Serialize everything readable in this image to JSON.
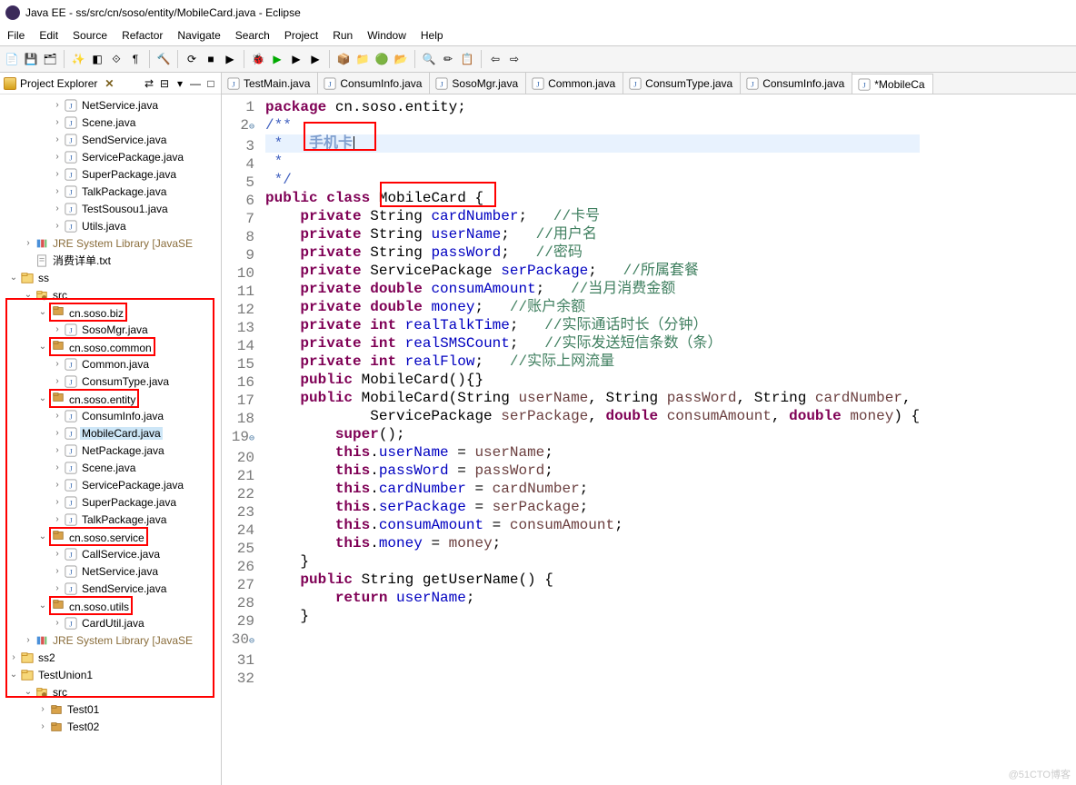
{
  "title": "Java EE - ss/src/cn/soso/entity/MobileCard.java - Eclipse",
  "menu": [
    "File",
    "Edit",
    "Source",
    "Refactor",
    "Navigate",
    "Search",
    "Project",
    "Run",
    "Window",
    "Help"
  ],
  "projectExplorer": {
    "title": "Project Explorer",
    "badge": "✕",
    "nodes": [
      {
        "depth": 3,
        "arrow": " >",
        "icon": "J",
        "label": "NetService.java"
      },
      {
        "depth": 3,
        "arrow": " >",
        "icon": "J",
        "label": "Scene.java"
      },
      {
        "depth": 3,
        "arrow": " >",
        "icon": "J",
        "label": "SendService.java"
      },
      {
        "depth": 3,
        "arrow": " >",
        "icon": "J",
        "label": "ServicePackage.java"
      },
      {
        "depth": 3,
        "arrow": " >",
        "icon": "J",
        "label": "SuperPackage.java"
      },
      {
        "depth": 3,
        "arrow": " >",
        "icon": "J",
        "label": "TalkPackage.java"
      },
      {
        "depth": 3,
        "arrow": " >",
        "icon": "J",
        "label": "TestSousou1.java"
      },
      {
        "depth": 3,
        "arrow": " >",
        "icon": "J",
        "label": "Utils.java"
      },
      {
        "depth": 1,
        "arrow": " >",
        "icon": "lib",
        "label": "JRE System Library [JavaSE"
      },
      {
        "depth": 1,
        "arrow": "",
        "icon": "txt",
        "label": "消费详单.txt"
      },
      {
        "depth": 0,
        "arrow": "v",
        "icon": "proj",
        "label": "ss"
      },
      {
        "depth": 1,
        "arrow": "v",
        "icon": "srcf",
        "label": "src"
      },
      {
        "depth": 2,
        "arrow": "v",
        "icon": "pkg",
        "label": "cn.soso.biz",
        "boxed": true
      },
      {
        "depth": 3,
        "arrow": " >",
        "icon": "J",
        "label": "SosoMgr.java"
      },
      {
        "depth": 2,
        "arrow": "v",
        "icon": "pkg",
        "label": "cn.soso.common",
        "boxed": true
      },
      {
        "depth": 3,
        "arrow": " >",
        "icon": "J",
        "label": "Common.java"
      },
      {
        "depth": 3,
        "arrow": " >",
        "icon": "J",
        "label": "ConsumType.java"
      },
      {
        "depth": 2,
        "arrow": "v",
        "icon": "pkg",
        "label": "cn.soso.entity",
        "boxed": true
      },
      {
        "depth": 3,
        "arrow": " >",
        "icon": "J",
        "label": "ConsumInfo.java"
      },
      {
        "depth": 3,
        "arrow": " >",
        "icon": "J",
        "label": "MobileCard.java",
        "sel": true
      },
      {
        "depth": 3,
        "arrow": " >",
        "icon": "J",
        "label": "NetPackage.java"
      },
      {
        "depth": 3,
        "arrow": " >",
        "icon": "J",
        "label": "Scene.java"
      },
      {
        "depth": 3,
        "arrow": " >",
        "icon": "J",
        "label": "ServicePackage.java"
      },
      {
        "depth": 3,
        "arrow": " >",
        "icon": "J",
        "label": "SuperPackage.java"
      },
      {
        "depth": 3,
        "arrow": " >",
        "icon": "J",
        "label": "TalkPackage.java"
      },
      {
        "depth": 2,
        "arrow": "v",
        "icon": "pkg",
        "label": "cn.soso.service",
        "boxed": true
      },
      {
        "depth": 3,
        "arrow": " >",
        "icon": "J",
        "label": "CallService.java"
      },
      {
        "depth": 3,
        "arrow": " >",
        "icon": "J",
        "label": "NetService.java"
      },
      {
        "depth": 3,
        "arrow": " >",
        "icon": "J",
        "label": "SendService.java"
      },
      {
        "depth": 2,
        "arrow": "v",
        "icon": "pkg",
        "label": "cn.soso.utils",
        "boxed": true
      },
      {
        "depth": 3,
        "arrow": " >",
        "icon": "J",
        "label": "CardUtil.java"
      },
      {
        "depth": 1,
        "arrow": " >",
        "icon": "lib",
        "label": "JRE System Library [JavaSE"
      },
      {
        "depth": 0,
        "arrow": " >",
        "icon": "proj",
        "label": "ss2"
      },
      {
        "depth": 0,
        "arrow": "v",
        "icon": "proj",
        "label": "TestUnion1"
      },
      {
        "depth": 1,
        "arrow": "v",
        "icon": "srcf",
        "label": "src"
      },
      {
        "depth": 2,
        "arrow": " >",
        "icon": "pkg",
        "label": "Test01"
      },
      {
        "depth": 2,
        "arrow": " >",
        "icon": "pkg",
        "label": "Test02"
      }
    ]
  },
  "tabs": [
    {
      "label": "TestMain.java"
    },
    {
      "label": "ConsumInfo.java"
    },
    {
      "label": "SosoMgr.java"
    },
    {
      "label": "Common.java"
    },
    {
      "label": "ConsumType.java"
    },
    {
      "label": "ConsumInfo.java"
    },
    {
      "label": "*MobileCa",
      "active": true
    }
  ],
  "code": {
    "lines": [
      {
        "n": 1,
        "seg": [
          [
            "kw",
            "package"
          ],
          [
            "tk",
            " cn.soso.entity"
          ],
          [
            "tk",
            ";"
          ]
        ]
      },
      {
        "n": 2,
        "fold": "⊖",
        "seg": [
          [
            "jd",
            "/**"
          ]
        ]
      },
      {
        "n": 3,
        "hl": true,
        "seg": [
          [
            "jd",
            " *   "
          ],
          [
            "jdk",
            "手机卡"
          ],
          [
            "cursor",
            ""
          ]
        ]
      },
      {
        "n": 4,
        "seg": [
          [
            "jd",
            " *"
          ]
        ]
      },
      {
        "n": 5,
        "seg": [
          [
            "jd",
            " */"
          ]
        ]
      },
      {
        "n": 6,
        "seg": [
          [
            "kw",
            "public"
          ],
          [
            "tk",
            " "
          ],
          [
            "kw",
            "class"
          ],
          [
            "tk",
            " MobileCard "
          ],
          [
            "tk",
            "{"
          ]
        ]
      },
      {
        "n": 7,
        "seg": [
          [
            "tk",
            "    "
          ],
          [
            "kw",
            "private"
          ],
          [
            "tk",
            " String "
          ],
          [
            "fld",
            "cardNumber"
          ],
          [
            "tk",
            ";   "
          ],
          [
            "cm",
            "//卡号"
          ]
        ]
      },
      {
        "n": 8,
        "seg": [
          [
            "tk",
            "    "
          ],
          [
            "kw",
            "private"
          ],
          [
            "tk",
            " String "
          ],
          [
            "fld",
            "userName"
          ],
          [
            "tk",
            ";   "
          ],
          [
            "cm",
            "//用户名"
          ]
        ]
      },
      {
        "n": 9,
        "seg": [
          [
            "tk",
            "    "
          ],
          [
            "kw",
            "private"
          ],
          [
            "tk",
            " String "
          ],
          [
            "fld",
            "passWord"
          ],
          [
            "tk",
            ";   "
          ],
          [
            "cm",
            "//密码"
          ]
        ]
      },
      {
        "n": 10,
        "seg": [
          [
            "tk",
            "    "
          ],
          [
            "kw",
            "private"
          ],
          [
            "tk",
            " ServicePackage "
          ],
          [
            "fld",
            "serPackage"
          ],
          [
            "tk",
            ";   "
          ],
          [
            "cm",
            "//所属套餐"
          ]
        ]
      },
      {
        "n": 11,
        "seg": [
          [
            "tk",
            "    "
          ],
          [
            "kw",
            "private"
          ],
          [
            "tk",
            " "
          ],
          [
            "kw",
            "double"
          ],
          [
            "tk",
            " "
          ],
          [
            "fld",
            "consumAmount"
          ],
          [
            "tk",
            ";   "
          ],
          [
            "cm",
            "//当月消费金额"
          ]
        ]
      },
      {
        "n": 12,
        "seg": [
          [
            "tk",
            "    "
          ],
          [
            "kw",
            "private"
          ],
          [
            "tk",
            " "
          ],
          [
            "kw",
            "double"
          ],
          [
            "tk",
            " "
          ],
          [
            "fld",
            "money"
          ],
          [
            "tk",
            ";   "
          ],
          [
            "cm",
            "//账户余额"
          ]
        ]
      },
      {
        "n": 13,
        "seg": [
          [
            "tk",
            "    "
          ],
          [
            "kw",
            "private"
          ],
          [
            "tk",
            " "
          ],
          [
            "kw",
            "int"
          ],
          [
            "tk",
            " "
          ],
          [
            "fld",
            "realTalkTime"
          ],
          [
            "tk",
            ";   "
          ],
          [
            "cm",
            "//实际通话时长（分钟）"
          ]
        ]
      },
      {
        "n": 14,
        "seg": [
          [
            "tk",
            "    "
          ],
          [
            "kw",
            "private"
          ],
          [
            "tk",
            " "
          ],
          [
            "kw",
            "int"
          ],
          [
            "tk",
            " "
          ],
          [
            "fld",
            "realSMSCount"
          ],
          [
            "tk",
            ";   "
          ],
          [
            "cm",
            "//实际发送短信条数（条）"
          ]
        ]
      },
      {
        "n": 15,
        "seg": [
          [
            "tk",
            "    "
          ],
          [
            "kw",
            "private"
          ],
          [
            "tk",
            " "
          ],
          [
            "kw",
            "int"
          ],
          [
            "tk",
            " "
          ],
          [
            "fld",
            "realFlow"
          ],
          [
            "tk",
            ";   "
          ],
          [
            "cm",
            "//实际上网流量"
          ]
        ]
      },
      {
        "n": 16,
        "seg": [
          [
            "tk",
            ""
          ]
        ]
      },
      {
        "n": 17,
        "seg": [
          [
            "tk",
            "    "
          ],
          [
            "kw",
            "public"
          ],
          [
            "tk",
            " MobileCard(){}"
          ]
        ]
      },
      {
        "n": 18,
        "seg": [
          [
            "tk",
            ""
          ]
        ]
      },
      {
        "n": 19,
        "fold": "⊖",
        "seg": [
          [
            "tk",
            "    "
          ],
          [
            "kw",
            "public"
          ],
          [
            "tk",
            " MobileCard(String "
          ],
          [
            "param",
            "userName"
          ],
          [
            "tk",
            ", String "
          ],
          [
            "param",
            "passWord"
          ],
          [
            "tk",
            ", String "
          ],
          [
            "param",
            "cardNumber"
          ],
          [
            "tk",
            ","
          ]
        ]
      },
      {
        "n": 20,
        "seg": [
          [
            "tk",
            "            ServicePackage "
          ],
          [
            "param",
            "serPackage"
          ],
          [
            "tk",
            ", "
          ],
          [
            "kw",
            "double"
          ],
          [
            "tk",
            " "
          ],
          [
            "param",
            "consumAmount"
          ],
          [
            "tk",
            ", "
          ],
          [
            "kw",
            "double"
          ],
          [
            "tk",
            " "
          ],
          [
            "param",
            "money"
          ],
          [
            "tk",
            ") {"
          ]
        ]
      },
      {
        "n": 21,
        "seg": [
          [
            "tk",
            "        "
          ],
          [
            "kw",
            "super"
          ],
          [
            "tk",
            "();"
          ]
        ]
      },
      {
        "n": 22,
        "seg": [
          [
            "tk",
            "        "
          ],
          [
            "kw",
            "this"
          ],
          [
            "tk",
            "."
          ],
          [
            "fld",
            "userName"
          ],
          [
            "tk",
            " = "
          ],
          [
            "param",
            "userName"
          ],
          [
            "tk",
            ";"
          ]
        ]
      },
      {
        "n": 23,
        "seg": [
          [
            "tk",
            "        "
          ],
          [
            "kw",
            "this"
          ],
          [
            "tk",
            "."
          ],
          [
            "fld",
            "passWord"
          ],
          [
            "tk",
            " = "
          ],
          [
            "param",
            "passWord"
          ],
          [
            "tk",
            ";"
          ]
        ]
      },
      {
        "n": 24,
        "seg": [
          [
            "tk",
            "        "
          ],
          [
            "kw",
            "this"
          ],
          [
            "tk",
            "."
          ],
          [
            "fld",
            "cardNumber"
          ],
          [
            "tk",
            " = "
          ],
          [
            "param",
            "cardNumber"
          ],
          [
            "tk",
            ";"
          ]
        ]
      },
      {
        "n": 25,
        "seg": [
          [
            "tk",
            "        "
          ],
          [
            "kw",
            "this"
          ],
          [
            "tk",
            "."
          ],
          [
            "fld",
            "serPackage"
          ],
          [
            "tk",
            " = "
          ],
          [
            "param",
            "serPackage"
          ],
          [
            "tk",
            ";"
          ]
        ]
      },
      {
        "n": 26,
        "seg": [
          [
            "tk",
            "        "
          ],
          [
            "kw",
            "this"
          ],
          [
            "tk",
            "."
          ],
          [
            "fld",
            "consumAmount"
          ],
          [
            "tk",
            " = "
          ],
          [
            "param",
            "consumAmount"
          ],
          [
            "tk",
            ";"
          ]
        ]
      },
      {
        "n": 27,
        "seg": [
          [
            "tk",
            "        "
          ],
          [
            "kw",
            "this"
          ],
          [
            "tk",
            "."
          ],
          [
            "fld",
            "money"
          ],
          [
            "tk",
            " = "
          ],
          [
            "param",
            "money"
          ],
          [
            "tk",
            ";"
          ]
        ]
      },
      {
        "n": 28,
        "seg": [
          [
            "tk",
            "    }"
          ]
        ]
      },
      {
        "n": 29,
        "seg": [
          [
            "tk",
            ""
          ]
        ]
      },
      {
        "n": 30,
        "fold": "⊖",
        "seg": [
          [
            "tk",
            "    "
          ],
          [
            "kw",
            "public"
          ],
          [
            "tk",
            " String getUserName() {"
          ]
        ]
      },
      {
        "n": 31,
        "seg": [
          [
            "tk",
            "        "
          ],
          [
            "kw",
            "return"
          ],
          [
            "tk",
            " "
          ],
          [
            "fld",
            "userName"
          ],
          [
            "tk",
            ";"
          ]
        ]
      },
      {
        "n": 32,
        "seg": [
          [
            "tk",
            "    }"
          ]
        ]
      }
    ]
  },
  "watermark": "@51CTO博客"
}
